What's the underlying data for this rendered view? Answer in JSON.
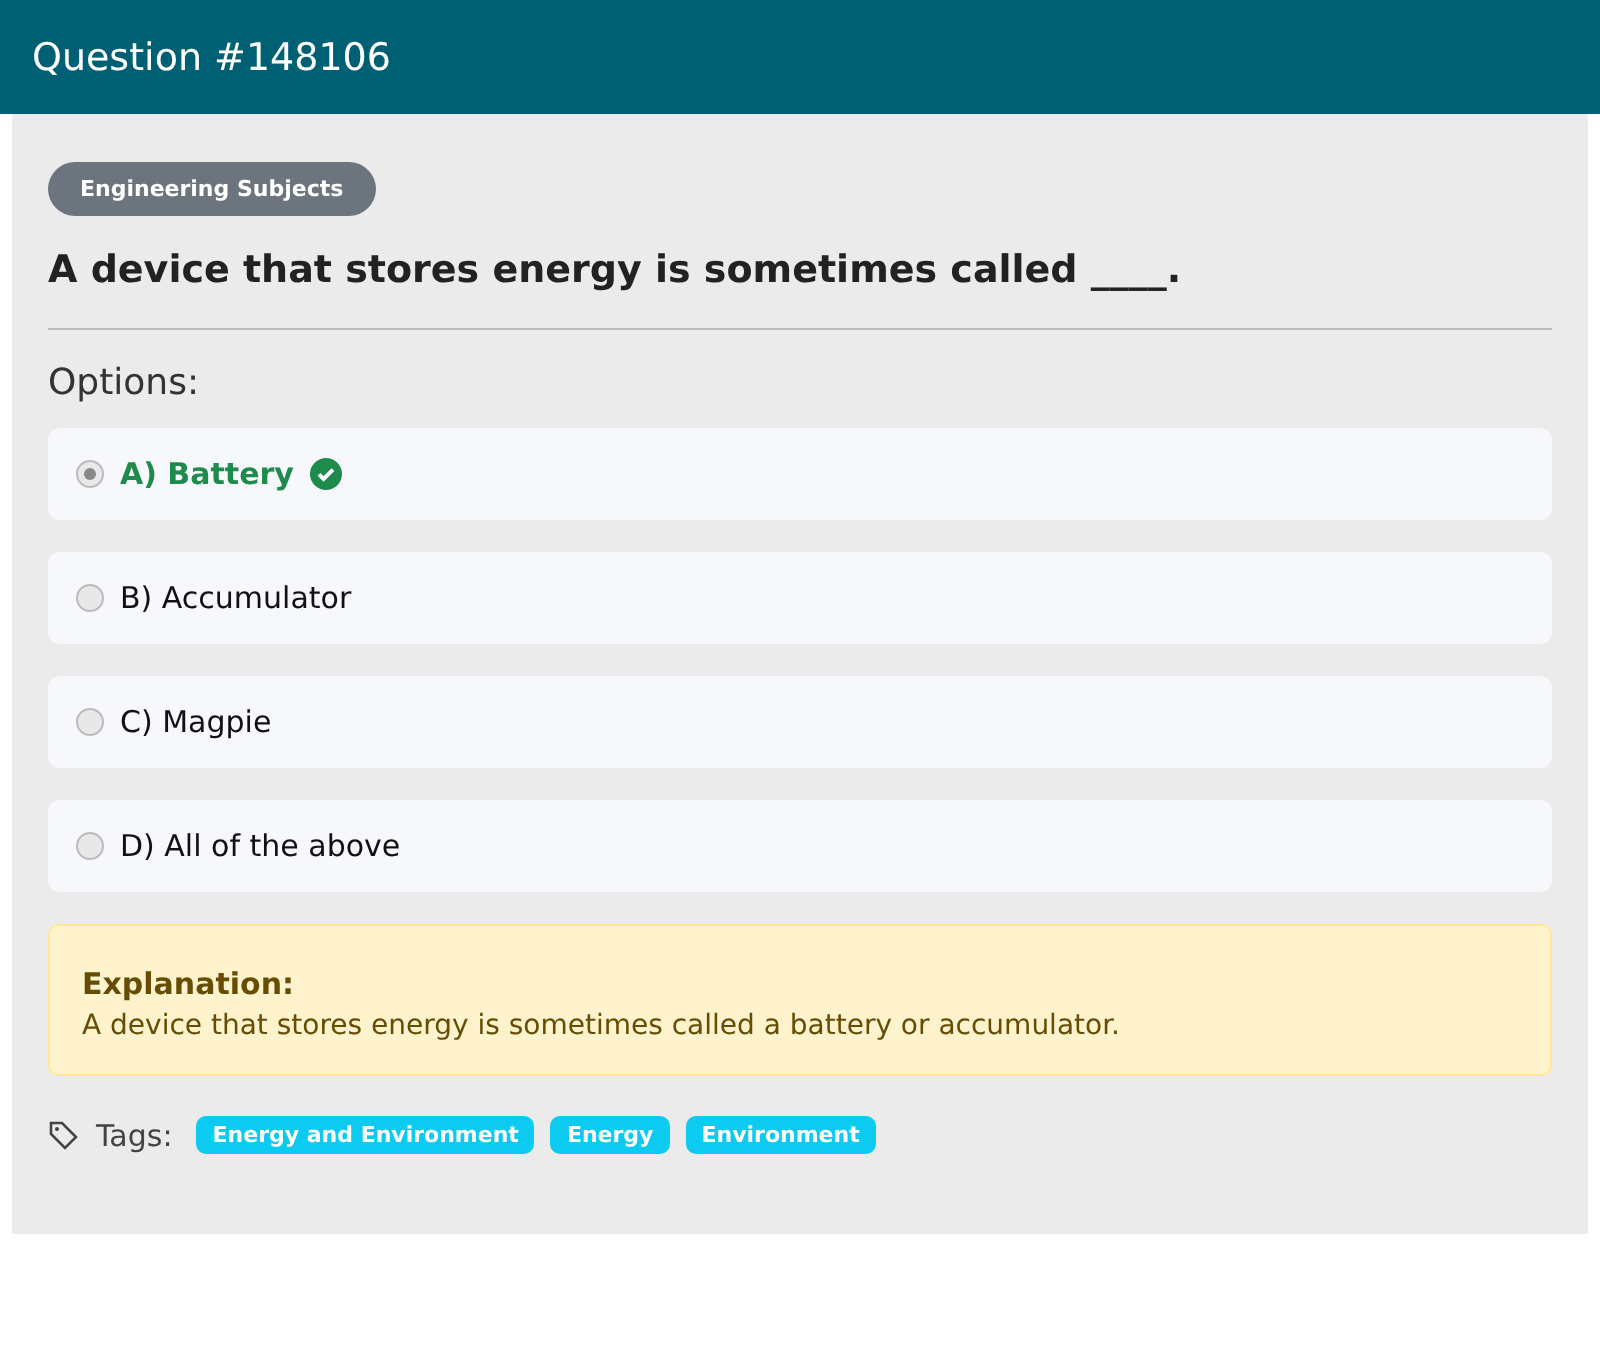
{
  "header": {
    "title": "Question #148106"
  },
  "category": "Engineering Subjects",
  "question": "A device that stores energy is sometimes called ____.",
  "options_label": "Options:",
  "options": [
    {
      "label": "A) Battery",
      "selected": true,
      "correct": true
    },
    {
      "label": "B) Accumulator",
      "selected": false,
      "correct": false
    },
    {
      "label": "C) Magpie",
      "selected": false,
      "correct": false
    },
    {
      "label": "D) All of the above",
      "selected": false,
      "correct": false
    }
  ],
  "explanation": {
    "title": "Explanation:",
    "text": "A device that stores energy is sometimes called a battery or accumulator."
  },
  "tags_label": "Tags:",
  "tags": [
    "Energy and Environment",
    "Energy",
    "Environment"
  ]
}
